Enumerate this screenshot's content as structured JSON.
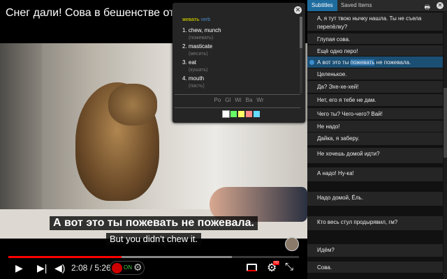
{
  "video": {
    "title": "Снег дали! Сова в бешенстве от того,",
    "caption_ru": "А вот это ты пожевать не пожевала.",
    "caption_en": "But you didn't chew it.",
    "time": "2:08 / 5:26",
    "progress_percent": 39,
    "buffered_percent": 77,
    "extension_status": "ON"
  },
  "popup": {
    "word": "жевать",
    "pos": "verb",
    "definitions": [
      {
        "n": "1.",
        "text": "chew, munch",
        "ru": "(пожевать)"
      },
      {
        "n": "2.",
        "text": "masticate",
        "ru": "(месить)"
      },
      {
        "n": "3.",
        "text": "eat",
        "ru": "(кушать)"
      },
      {
        "n": "4.",
        "text": "mouth",
        "ru": "(пасть)"
      }
    ],
    "sources": [
      "Po",
      "Gl",
      "Wi",
      "Ba",
      "Wr"
    ],
    "colors": [
      "#ffffff",
      "#66ff66",
      "#ffff66",
      "#ff8888",
      "#66ddff"
    ]
  },
  "panel": {
    "tabs": [
      "Subtitles",
      "Saved Items"
    ],
    "rows": [
      {
        "text": "А, я тут твою нычку нашла. Ты не съела перепёлку?"
      },
      {
        "text": "Глупая сова."
      },
      {
        "text": "Ещё одно перо!"
      },
      {
        "pre": "А вот это ты ",
        "hl": "пожевать",
        "post": " не пожевала."
      },
      {
        "text": "Целенькое."
      },
      {
        "text": "Да? Эхе-хе-хей!"
      },
      {
        "text": "Нет, его я тебе не дам."
      },
      {
        "text": "Чего ты? Чего-чего? Вай!"
      },
      {
        "text": "Не надо!"
      },
      {
        "text": "Дайка, я заберу."
      },
      {
        "text": "Не хочешь домой идти?"
      },
      {
        "text": "А надо! Ну-ка!"
      },
      {
        "text": "Надо домой, Ёль."
      },
      {
        "text": "Кто весь стул продырявил, гм?"
      },
      {
        "text": "Идём?"
      },
      {
        "text": "Сова."
      }
    ]
  }
}
